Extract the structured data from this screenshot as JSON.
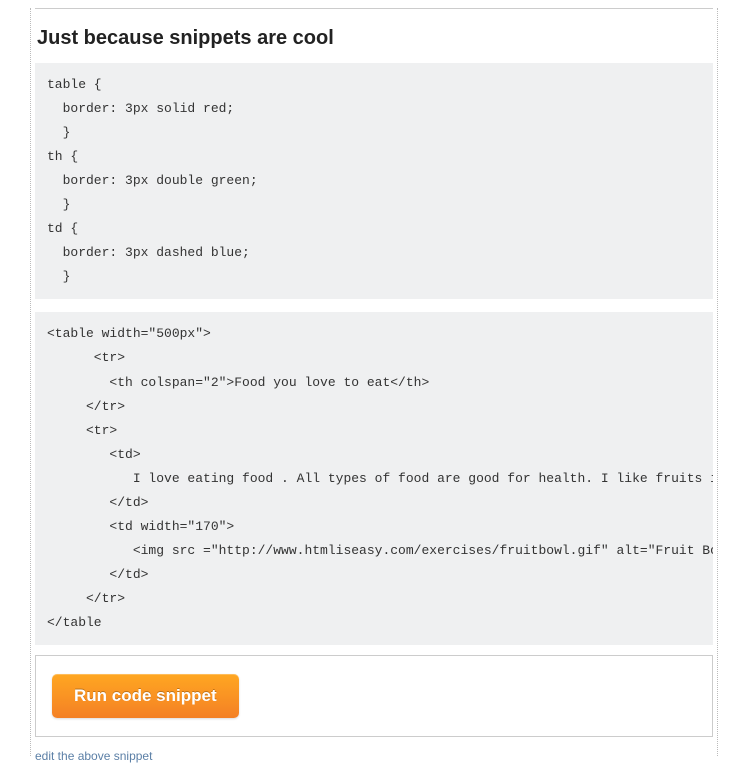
{
  "heading": "Just because snippets are cool",
  "code_css": "table {\n  border: 3px solid red;\n  }\nth {\n  border: 3px double green;\n  }\ntd {\n  border: 3px dashed blue;\n  }",
  "code_html": "<table width=\"500px\">\n      <tr>\n        <th colspan=\"2\">Food you love to eat</th>\n     </tr>\n     <tr>\n        <td>\n           I love eating food . All types of food are good for health. I like fruits in them. Fruits are healthy\n        </td>\n        <td width=\"170\">\n           <img src =\"http://www.htmliseasy.com/exercises/fruitbowl.gif\" alt=\"Fruit Bowl\" />\n        </td>\n     </tr>\n</table",
  "run_button_label": "Run code snippet",
  "edit_link_label": "edit the above snippet"
}
